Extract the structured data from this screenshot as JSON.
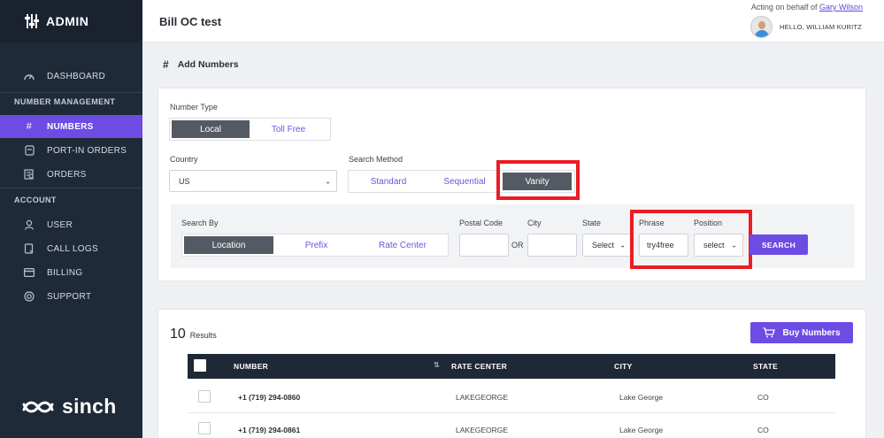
{
  "brand": {
    "title": "ADMIN",
    "icon": "sliders-icon"
  },
  "sidebar": {
    "dashboard": "DASHBOARD",
    "number_management_label": "NUMBER MANAGEMENT",
    "numbers": "NUMBERS",
    "port_in_orders": "PORT-IN ORDERS",
    "orders": "ORDERS",
    "account_label": "ACCOUNT",
    "user": "USER",
    "call_logs": "CALL LOGS",
    "billing": "BILLING",
    "support": "SUPPORT",
    "footer_logo": "sinch",
    "active_color": "#6c4ce3"
  },
  "header": {
    "title": "Bill OC test",
    "acting_prefix": "Acting on behalf of",
    "acting_user": "Gary Wilson",
    "greeting": "HELLO, WILLIAM KURITZ"
  },
  "section": {
    "icon": "#",
    "title": "Add Numbers"
  },
  "form": {
    "number_type_label": "Number Type",
    "number_type_options": [
      "Local",
      "Toll Free"
    ],
    "number_type_selected": "Local",
    "country_label": "Country",
    "country_value": "US",
    "search_method_label": "Search Method",
    "search_method_options": [
      "Standard",
      "Sequential",
      "Vanity"
    ],
    "search_method_selected": "Vanity",
    "search_by_label": "Search By",
    "search_by_options": [
      "Location",
      "Prefix",
      "Rate Center"
    ],
    "search_by_selected": "Location",
    "postal_code_label": "Postal Code",
    "postal_code_value": "",
    "or_text": "OR",
    "city_label": "City",
    "city_value": "",
    "state_label": "State",
    "state_value": "Select",
    "phrase_label": "Phrase",
    "phrase_value": "try4free",
    "position_label": "Position",
    "position_value": "select",
    "search_button": "SEARCH"
  },
  "results": {
    "count": "10",
    "label": "Results",
    "buy_button": "Buy Numbers",
    "columns": [
      "NUMBER",
      "RATE CENTER",
      "CITY",
      "STATE"
    ],
    "rows": [
      {
        "number": "+1 (719) 294-0860",
        "rate_center": "LAKEGEORGE",
        "city": "Lake George",
        "state": "CO"
      },
      {
        "number": "+1 (719) 294-0861",
        "rate_center": "LAKEGEORGE",
        "city": "Lake George",
        "state": "CO"
      }
    ]
  },
  "colors": {
    "accent": "#6c4ce3",
    "highlight_border": "#ea1c24",
    "sidebar_bg": "#1f2a38"
  }
}
